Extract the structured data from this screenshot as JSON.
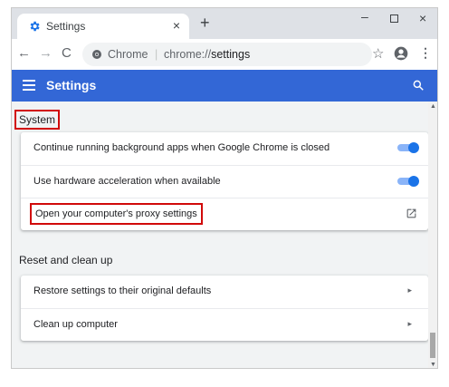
{
  "browser": {
    "tab_title": "Settings",
    "tab_close": "×",
    "new_tab": "+",
    "window_minimize": "–",
    "window_close": "×",
    "nav_back": "←",
    "nav_forward": "→",
    "nav_reload": "C",
    "omnibox_site": "Chrome",
    "omnibox_sep": "|",
    "omnibox_url_prefix": "chrome://",
    "omnibox_url_path": "settings",
    "star": "☆",
    "menu": "⋮",
    "icons": [
      "settings-favicon",
      "chrome-icon",
      "star-icon",
      "profile-icon",
      "menu-icon"
    ]
  },
  "header": {
    "title": "Settings",
    "background": "#3367d6"
  },
  "system": {
    "title": "System",
    "rows": [
      {
        "label": "Continue running background apps when Google Chrome is closed",
        "control": "toggle",
        "on": true
      },
      {
        "label": "Use hardware acceleration when available",
        "control": "toggle",
        "on": true
      },
      {
        "label": "Open your computer's proxy settings",
        "control": "external-link"
      }
    ]
  },
  "reset": {
    "title": "Reset and clean up",
    "rows": [
      {
        "label": "Restore settings to their original defaults",
        "control": "arrow"
      },
      {
        "label": "Clean up computer",
        "control": "arrow"
      }
    ],
    "arrow": "▸"
  },
  "colors": {
    "accent": "#1a73e8",
    "highlight_border": "#d10a0a"
  }
}
